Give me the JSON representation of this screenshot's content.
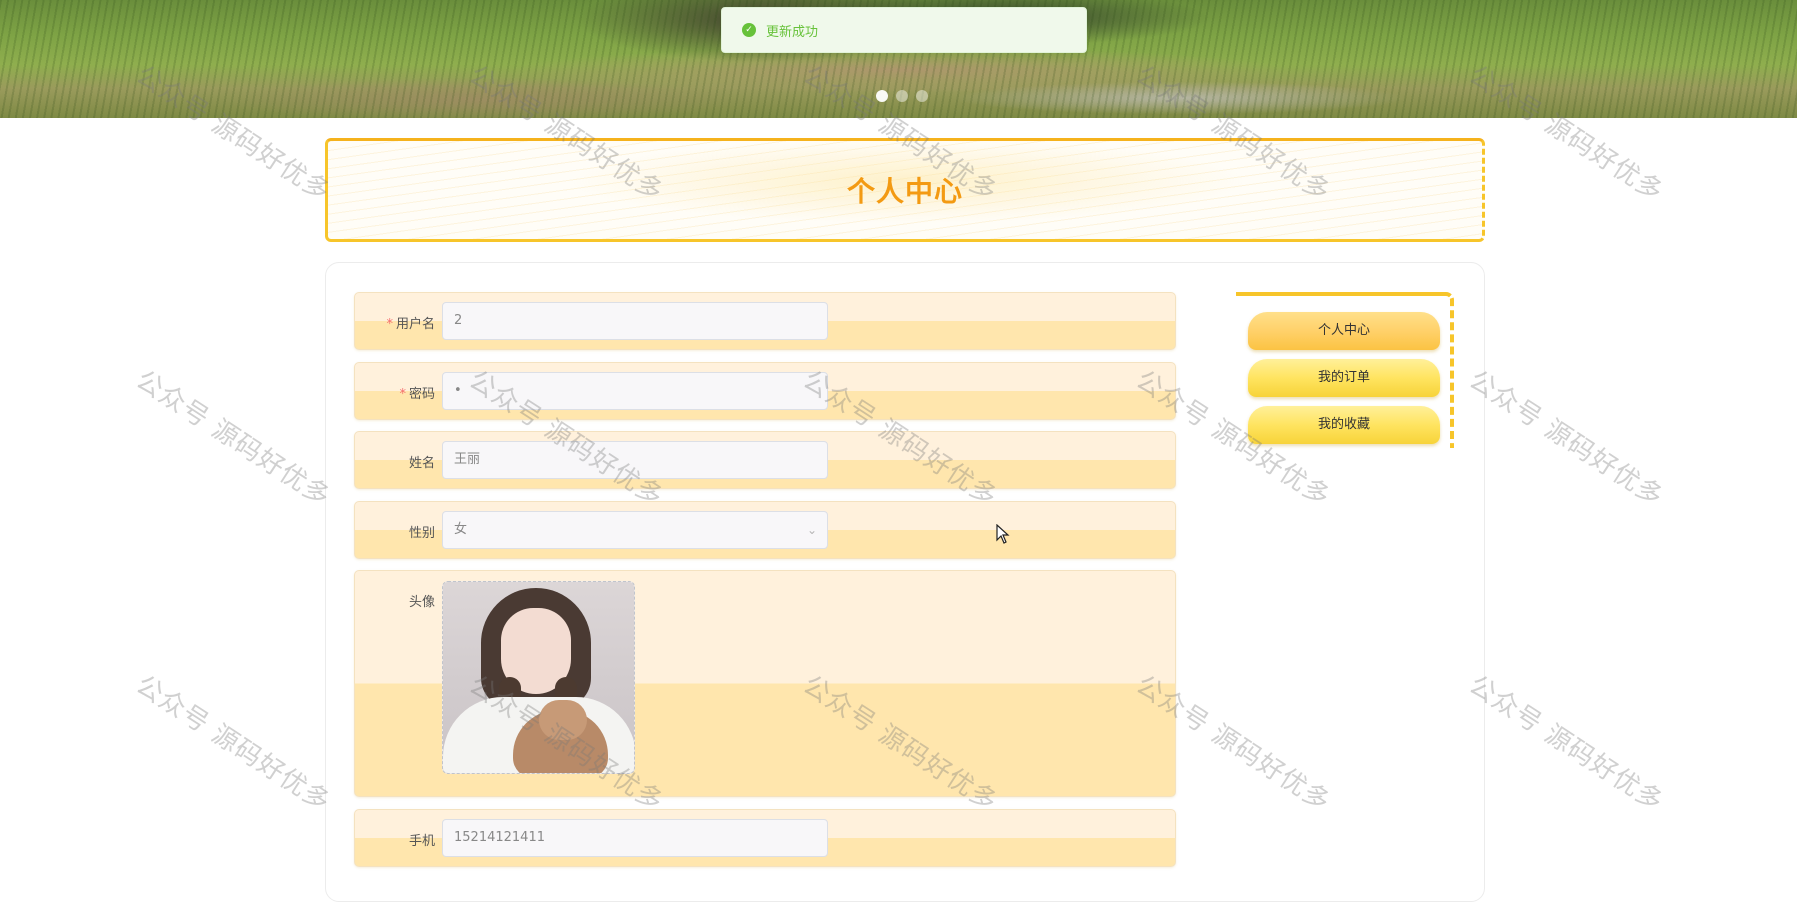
{
  "toast": {
    "text": "更新成功",
    "status": "success"
  },
  "banner": {
    "dots": 3,
    "active_dot": 1
  },
  "title": "个人中心",
  "form": {
    "username": {
      "label": "用户名",
      "required": true,
      "value": "2"
    },
    "password": {
      "label": "密码",
      "required": true,
      "value": "•"
    },
    "name": {
      "label": "姓名",
      "required": false,
      "value": "王丽"
    },
    "gender": {
      "label": "性别",
      "required": false,
      "value": "女"
    },
    "avatar": {
      "label": "头像"
    },
    "phone": {
      "label": "手机",
      "required": false,
      "value": "15214121411"
    }
  },
  "side_menu": {
    "items": [
      {
        "label": "个人中心",
        "active": true
      },
      {
        "label": "我的订单",
        "active": false
      },
      {
        "label": "我的收藏",
        "active": false
      }
    ]
  },
  "watermark": "公众号 源码好优多",
  "colors": {
    "accent": "#f39a12",
    "frame": "#f7c52a",
    "success": "#67c23a",
    "required": "#f56c6c"
  }
}
